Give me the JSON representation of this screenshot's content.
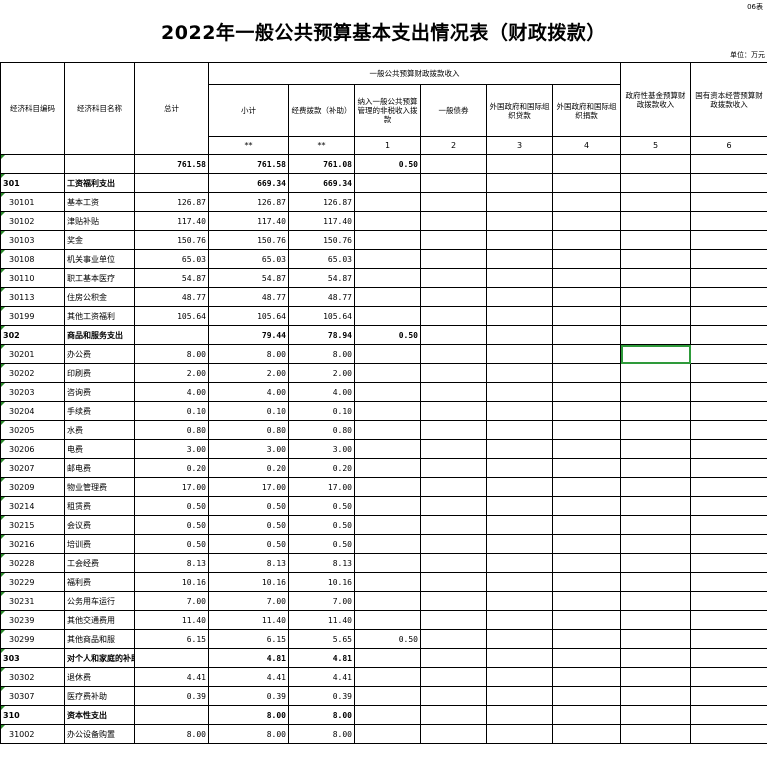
{
  "doc": {
    "code_tag": "06表",
    "title": "2022年一般公共预算基本支出情况表（财政拨款）",
    "unit": "单位：万元"
  },
  "header": {
    "col_code": "经济科目编码",
    "col_name": "经济科目名称",
    "col_total": "总计",
    "group_general": "一般公共预算财政拨款收入",
    "subtotal": "小计",
    "funds": "经费拨款（补助）",
    "non_tax": "纳入一般公共预算管理的非税收入拨款",
    "bond": "一般债券",
    "foreign_loan": "外国政府和国际组织贷款",
    "foreign_grant": "外国政府和国际组织捐款",
    "gov_fund": "政府性基金预算财政拨款收入",
    "state_capital": "国有资本经营预算财政拨款收入"
  },
  "index_row": [
    "**",
    "**",
    "1",
    "2",
    "3",
    "4",
    "5",
    "6",
    "7",
    "8",
    "9"
  ],
  "rows": [
    {
      "code": "",
      "name": "",
      "total": "761.58",
      "sub": "761.58",
      "funds": "761.08",
      "nontax": "0.50",
      "bold": true
    },
    {
      "code": "301",
      "name": "工资福利支出",
      "total": "",
      "sub": "669.34",
      "funds": "669.34",
      "nontax": "",
      "bold": true
    },
    {
      "code": "30101",
      "name": "基本工资",
      "total": "126.87",
      "sub": "126.87",
      "funds": "126.87",
      "nontax": ""
    },
    {
      "code": "30102",
      "name": "津贴补贴",
      "total": "117.40",
      "sub": "117.40",
      "funds": "117.40",
      "nontax": ""
    },
    {
      "code": "30103",
      "name": "奖金",
      "total": "150.76",
      "sub": "150.76",
      "funds": "150.76",
      "nontax": ""
    },
    {
      "code": "30108",
      "name": "机关事业单位",
      "total": "65.03",
      "sub": "65.03",
      "funds": "65.03",
      "nontax": ""
    },
    {
      "code": "30110",
      "name": "职工基本医疗",
      "total": "54.87",
      "sub": "54.87",
      "funds": "54.87",
      "nontax": ""
    },
    {
      "code": "30113",
      "name": "住房公积金",
      "total": "48.77",
      "sub": "48.77",
      "funds": "48.77",
      "nontax": ""
    },
    {
      "code": "30199",
      "name": "其他工资福利",
      "total": "105.64",
      "sub": "105.64",
      "funds": "105.64",
      "nontax": ""
    },
    {
      "code": "302",
      "name": "商品和服务支出",
      "total": "",
      "sub": "79.44",
      "funds": "78.94",
      "nontax": "0.50",
      "bold": true
    },
    {
      "code": "30201",
      "name": "办公费",
      "total": "8.00",
      "sub": "8.00",
      "funds": "8.00",
      "nontax": ""
    },
    {
      "code": "30202",
      "name": "印刷费",
      "total": "2.00",
      "sub": "2.00",
      "funds": "2.00",
      "nontax": ""
    },
    {
      "code": "30203",
      "name": "咨询费",
      "total": "4.00",
      "sub": "4.00",
      "funds": "4.00",
      "nontax": ""
    },
    {
      "code": "30204",
      "name": "手续费",
      "total": "0.10",
      "sub": "0.10",
      "funds": "0.10",
      "nontax": ""
    },
    {
      "code": "30205",
      "name": "水费",
      "total": "0.80",
      "sub": "0.80",
      "funds": "0.80",
      "nontax": ""
    },
    {
      "code": "30206",
      "name": "电费",
      "total": "3.00",
      "sub": "3.00",
      "funds": "3.00",
      "nontax": ""
    },
    {
      "code": "30207",
      "name": "邮电费",
      "total": "0.20",
      "sub": "0.20",
      "funds": "0.20",
      "nontax": ""
    },
    {
      "code": "30209",
      "name": "物业管理费",
      "total": "17.00",
      "sub": "17.00",
      "funds": "17.00",
      "nontax": ""
    },
    {
      "code": "30214",
      "name": "租赁费",
      "total": "0.50",
      "sub": "0.50",
      "funds": "0.50",
      "nontax": ""
    },
    {
      "code": "30215",
      "name": "会议费",
      "total": "0.50",
      "sub": "0.50",
      "funds": "0.50",
      "nontax": ""
    },
    {
      "code": "30216",
      "name": "培训费",
      "total": "0.50",
      "sub": "0.50",
      "funds": "0.50",
      "nontax": ""
    },
    {
      "code": "30228",
      "name": "工会经费",
      "total": "8.13",
      "sub": "8.13",
      "funds": "8.13",
      "nontax": ""
    },
    {
      "code": "30229",
      "name": "福利费",
      "total": "10.16",
      "sub": "10.16",
      "funds": "10.16",
      "nontax": ""
    },
    {
      "code": "30231",
      "name": "公务用车运行",
      "total": "7.00",
      "sub": "7.00",
      "funds": "7.00",
      "nontax": ""
    },
    {
      "code": "30239",
      "name": "其他交通费用",
      "total": "11.40",
      "sub": "11.40",
      "funds": "11.40",
      "nontax": ""
    },
    {
      "code": "30299",
      "name": "其他商品和服",
      "total": "6.15",
      "sub": "6.15",
      "funds": "5.65",
      "nontax": "0.50"
    },
    {
      "code": "303",
      "name": "对个人和家庭的补助",
      "total": "",
      "sub": "4.81",
      "funds": "4.81",
      "nontax": "",
      "bold": true
    },
    {
      "code": "30302",
      "name": "退休费",
      "total": "4.41",
      "sub": "4.41",
      "funds": "4.41",
      "nontax": ""
    },
    {
      "code": "30307",
      "name": "医疗费补助",
      "total": "0.39",
      "sub": "0.39",
      "funds": "0.39",
      "nontax": ""
    },
    {
      "code": "310",
      "name": "资本性支出",
      "total": "",
      "sub": "8.00",
      "funds": "8.00",
      "nontax": "",
      "bold": true
    },
    {
      "code": "31002",
      "name": "办公设备购置",
      "total": "8.00",
      "sub": "8.00",
      "funds": "8.00",
      "nontax": ""
    }
  ],
  "selected_cell": {
    "row": 10,
    "col": 9
  }
}
